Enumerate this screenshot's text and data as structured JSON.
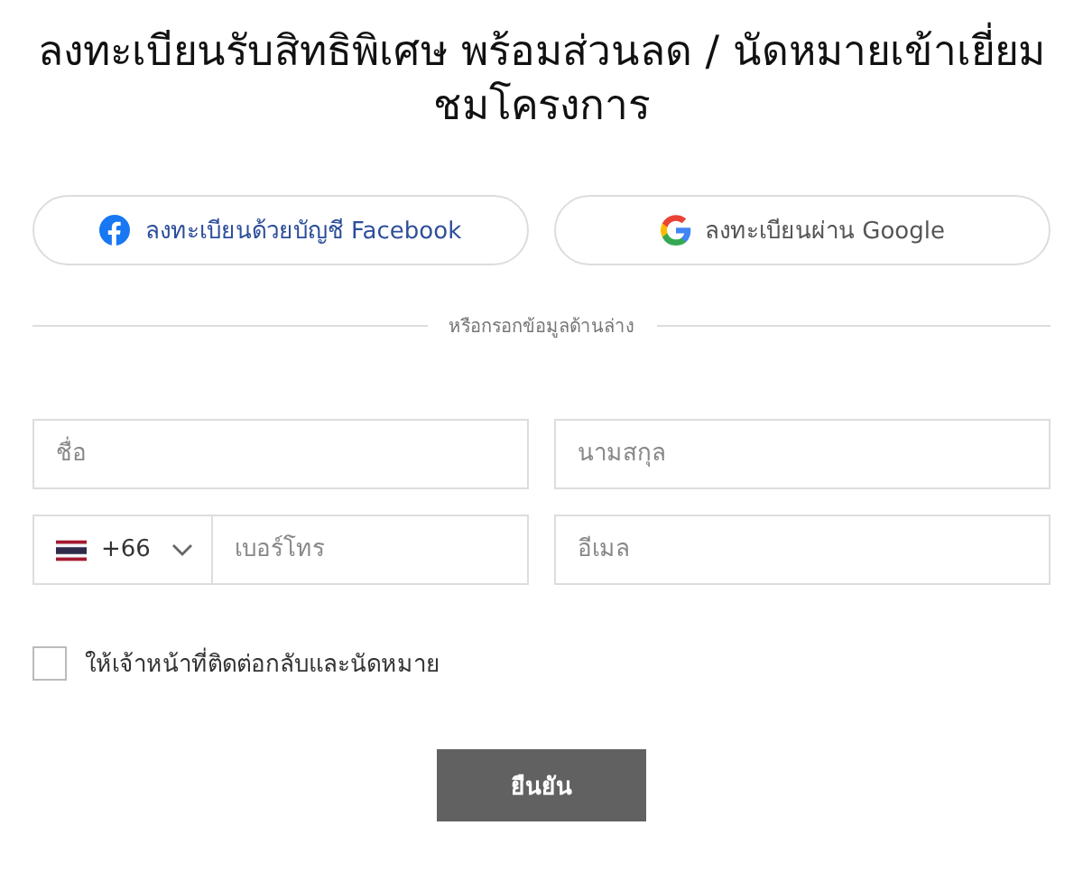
{
  "title": "ลงทะเบียนรับสิทธิพิเศษ พร้อมส่วนลด / นัดหมายเข้าเยี่ยมชมโครงการ",
  "social_buttons": [
    {
      "kind": "facebook",
      "label": "ลงทะเบียนด้วยบัญชี Facebook"
    },
    {
      "kind": "google",
      "label": "ลงทะเบียนผ่าน Google"
    }
  ],
  "divider_text": "หรือกรอกข้อมูลด้านล่าง",
  "fields": [
    {
      "kind": "text",
      "placeholder": "ชื่อ"
    },
    {
      "kind": "text",
      "placeholder": "นามสกุล"
    },
    {
      "kind": "phone",
      "country_code": "+66",
      "placeholder": "เบอร์โทร"
    },
    {
      "kind": "text",
      "placeholder": "อีเมล"
    }
  ],
  "consent": {
    "label": "ให้เจ้าหน้าที่ติดต่อกลับและนัดหมาย",
    "checked": false
  },
  "submit": "ยืนยัน"
}
